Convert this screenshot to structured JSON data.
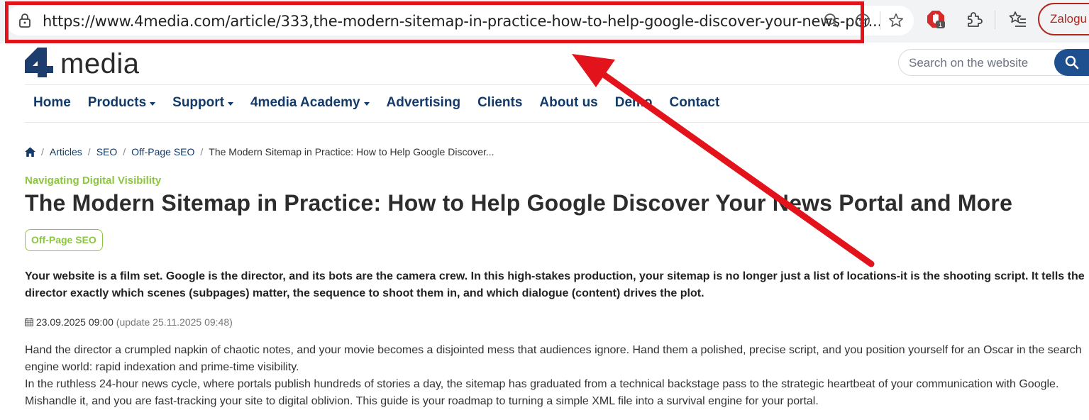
{
  "browser": {
    "url": "https://www.4media.com/article/333,the-modern-sitemap-in-practice-how-to-help-google-discover-your-news-por...",
    "profile_label": "Zalogu",
    "extension_badge": "1",
    "icons": [
      "lock-icon",
      "zoom-out-icon",
      "tracking-icon",
      "star-icon",
      "adblock-icon",
      "extensions-icon",
      "favorites-icon"
    ]
  },
  "site": {
    "logo_text": "media",
    "search_placeholder": "Search on the website"
  },
  "nav": {
    "home": "Home",
    "products": "Products",
    "support": "Support",
    "academy": "4media Academy",
    "advertising": "Advertising",
    "clients": "Clients",
    "about": "About us",
    "demo": "Demo",
    "contact": "Contact"
  },
  "breadcrumb": {
    "articles": "Articles",
    "seo": "SEO",
    "offpage": "Off-Page SEO",
    "current": "The Modern Sitemap in Practice: How to Help Google Discover..."
  },
  "article": {
    "kicker": "Navigating Digital Visibility",
    "title": "The Modern Sitemap in Practice: How to Help Google Discover Your News Portal and More",
    "tag": "Off-Page SEO",
    "lead": "Your website is a film set. Google is the director, and its bots are the camera crew. In this high-stakes production, your sitemap is no longer just a list of locations-it is the shooting script. It tells the director exactly which scenes (subpages) matter, the sequence to shoot them in, and which dialogue (content) drives the plot.",
    "date": "23.09.2025 09:00",
    "updated": "(update 25.11.2025 09:48)",
    "p1": "Hand the director a crumpled napkin of chaotic notes, and your movie becomes a disjointed mess that audiences ignore. Hand them a polished, precise script, and you position yourself for an Oscar in the search engine world: rapid indexation and prime-time visibility.",
    "p2": "In the ruthless 24-hour news cycle, where portals publish hundreds of stories a day, the sitemap has graduated from a technical backstage pass to the strategic heartbeat of your communication with Google. Mishandle it, and you are fast-tracking your site to digital oblivion. This guide is your roadmap to turning a simple XML file into a survival engine for your portal."
  },
  "colors": {
    "accent_green": "#8cc63f",
    "nav_blue": "#123a6a",
    "annotation_red": "#e3131b"
  }
}
